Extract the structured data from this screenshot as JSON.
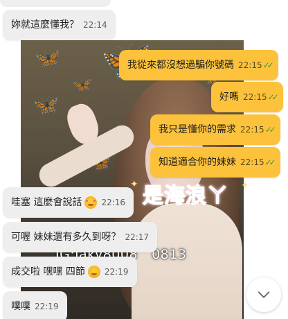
{
  "background_photo": {
    "overlay_text": "IG:jaky8008  0813"
  },
  "sticker": {
    "text": "是海浪ㄚ"
  },
  "messages": [
    {
      "direction": "in",
      "text": "妳就這麼懂我？",
      "time": "22:14",
      "emoji": ""
    },
    {
      "direction": "out",
      "text": "我從來都沒想過騙你號碼",
      "time": "22:15",
      "read": true
    },
    {
      "direction": "out",
      "text": "好嗎",
      "time": "22:15",
      "read": true
    },
    {
      "direction": "out",
      "text": "我只是懂你的需求",
      "time": "22:15",
      "read": true
    },
    {
      "direction": "out",
      "text": "知道適合你的妹妹",
      "time": "22:15",
      "read": true
    },
    {
      "direction": "in",
      "text": "哇塞 這麼會說話",
      "time": "22:16",
      "emoji": "smiling-face-with-hearts"
    },
    {
      "direction": "in",
      "text": "可喔 妹妹還有多久到呀？",
      "time": "22:17",
      "emoji": ""
    },
    {
      "direction": "in",
      "text": "成交啦 嘿嘿 四節",
      "time": "22:19",
      "emoji": "smiling-face"
    },
    {
      "direction": "in",
      "text": "噗噗",
      "time": "22:19",
      "emoji": ""
    }
  ],
  "read_receipt_icon": "double-check-icon",
  "scroll_button": {
    "icon": "chevron-down-icon"
  },
  "colors": {
    "outgoing_bubble": "#fcc23c",
    "incoming_bubble": "#eeeeee",
    "read_check": "#3b9a3b",
    "sticker": "#ff7eb6"
  }
}
